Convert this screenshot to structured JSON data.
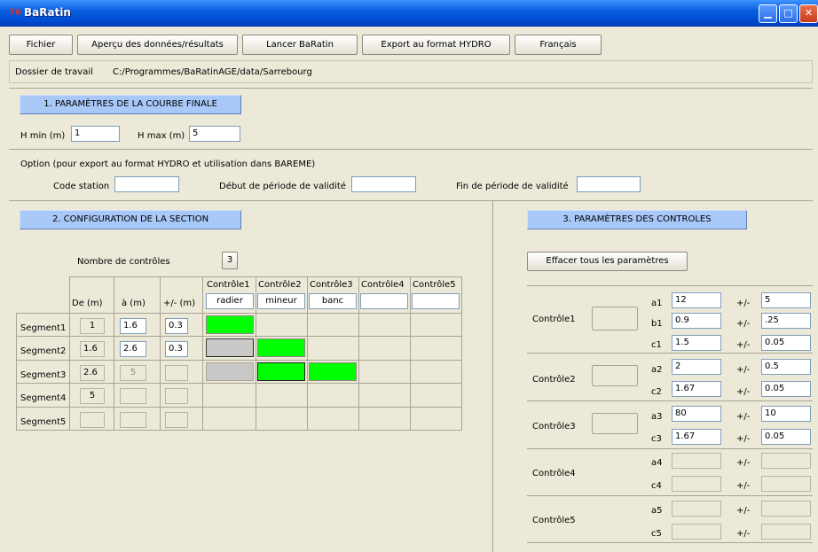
{
  "window": {
    "title": "BaRatin",
    "app_icon_text": "76"
  },
  "menu": {
    "fichier": "Fichier",
    "apercu": "Aperçu des données/résultats",
    "lancer": "Lancer BaRatin",
    "export": "Export au format HYDRO",
    "langue": "Français"
  },
  "workdir": {
    "label": "Dossier de travail",
    "path": "C:/Programmes/BaRatinAGE/data/Sarrebourg"
  },
  "section1": {
    "title": "1. PARAMÈTRES DE LA COURBE FINALE",
    "hmin_label": "H min (m)",
    "hmin_value": "1",
    "hmax_label": "H max (m)",
    "hmax_value": "5",
    "option_text": "Option (pour export au format HYDRO et utilisation dans BAREME)",
    "code_label": "Code station",
    "code_value": "",
    "debut_label": "Début de période de validité",
    "debut_value": "",
    "fin_label": "Fin de période de validité",
    "fin_value": ""
  },
  "section2": {
    "title": "2. CONFIGURATION DE LA SECTION",
    "nb_label": "Nombre de contrôles",
    "nb_value": "3",
    "col_de": "De (m)",
    "col_a": "à (m)",
    "col_pm": "+/- (m)",
    "controls": [
      "Contrôle1",
      "Contrôle2",
      "Contrôle3",
      "Contrôle4",
      "Contrôle5"
    ],
    "control_types": [
      "radier",
      "mineur",
      "banc",
      "",
      ""
    ],
    "segments": [
      {
        "label": "Segment1",
        "de": "1",
        "a": "1.6",
        "pm": "0.3"
      },
      {
        "label": "Segment2",
        "de": "1.6",
        "a": "2.6",
        "pm": "0.3"
      },
      {
        "label": "Segment3",
        "de": "2.6",
        "a": "5",
        "pm": ""
      },
      {
        "label": "Segment4",
        "de": "5",
        "a": "",
        "pm": ""
      },
      {
        "label": "Segment5",
        "de": "",
        "a": "",
        "pm": ""
      }
    ]
  },
  "section3": {
    "title": "3. PARAMÈTRES DES CONTROLES",
    "clear_button": "Effacer tous les paramètres",
    "pm": "+/-",
    "c1": {
      "label": "Contrôle1",
      "a1": "a1",
      "a1_v": "12",
      "a1_pm": "5",
      "b1": "b1",
      "b1_v": "0.9",
      "b1_pm": ".25",
      "c1": "c1",
      "c1_v": "1.5",
      "c1_pm": "0.05"
    },
    "c2": {
      "label": "Contrôle2",
      "a2": "a2",
      "a2_v": "2",
      "a2_pm": "0.5",
      "c2": "c2",
      "c2_v": "1.67",
      "c2_pm": "0.05"
    },
    "c3": {
      "label": "Contrôle3",
      "a3": "a3",
      "a3_v": "80",
      "a3_pm": "10",
      "c3": "c3",
      "c3_v": "1.67",
      "c3_pm": "0.05"
    },
    "c4": {
      "label": "Contrôle4",
      "a4": "a4",
      "c4": "c4"
    },
    "c5": {
      "label": "Contrôle5",
      "a5": "a5",
      "c5": "c5"
    }
  }
}
